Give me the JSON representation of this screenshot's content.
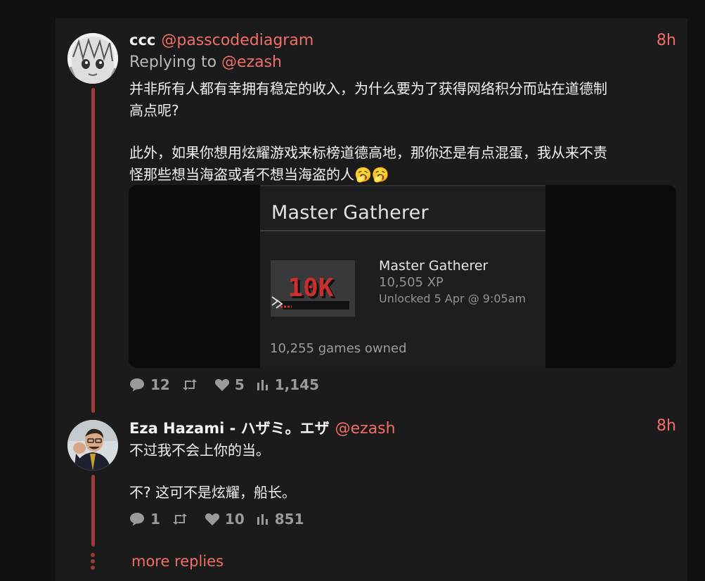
{
  "post1": {
    "name": "ccc",
    "handle": "@passcodediagram",
    "time": "8h",
    "reply_prefix": "Replying to",
    "reply_handle": "@ezash",
    "text_line1": "并非所有人都有幸拥有稳定的收入，为什么要为了获得网络积分而站在道德制",
    "text_line2": "高点呢?",
    "text_line3": "此外，如果你想用炫耀游戏来标榜道德高地，那你还是有点混蛋，我从来不责",
    "text_line4": "怪那些想当海盗或者不想当海盗的人🥱🥱",
    "media": {
      "header": "Master Gatherer",
      "badge_text": "10K",
      "achievement_name": "Master Gatherer",
      "xp": "10,505 XP",
      "unlocked": "Unlocked 5 Apr @ 9:05am",
      "games_owned": "10,255 games owned"
    },
    "stats": {
      "replies": "12",
      "likes": "5",
      "views": "1,145"
    }
  },
  "post2": {
    "name": "Eza Hazami - ハザミ。エザ",
    "handle": "@ezash",
    "time": "8h",
    "text_line1": "不过我不会上你的当。",
    "text_line2": "不? 这可不是炫耀，船长。",
    "stats": {
      "replies": "1",
      "likes": "10",
      "views": "851"
    }
  },
  "more_replies": "more replies",
  "colors": {
    "accent": "#f06e66",
    "thread": "#9e3b36",
    "panel": "#1b1b1b"
  },
  "icons": [
    "comment-icon",
    "repost-icon",
    "heart-icon",
    "views-icon"
  ]
}
